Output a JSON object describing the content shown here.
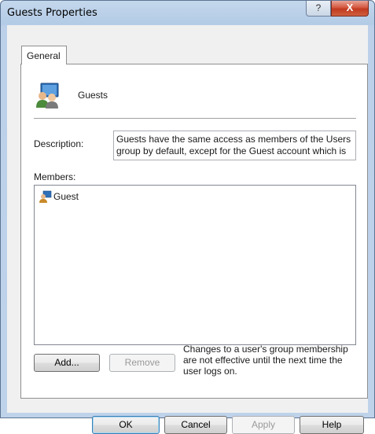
{
  "window": {
    "title": "Guests Properties",
    "help_glyph": "?",
    "close_glyph": "X"
  },
  "tabs": [
    {
      "label": "General"
    }
  ],
  "group": {
    "name": "Guests",
    "icon": "group-icon"
  },
  "description": {
    "label": "Description:",
    "line1": "Guests have the same access as members of the Users",
    "line2": "group by default, except for the Guest account which is"
  },
  "members": {
    "label": "Members:",
    "items": [
      {
        "label": "Guest",
        "icon": "user-icon"
      }
    ]
  },
  "member_buttons": {
    "add": "Add...",
    "remove": "Remove"
  },
  "note": {
    "line1": "Changes to a user's group membership",
    "line2": "are not effective until the next time the",
    "line3": "user logs on."
  },
  "dialog_buttons": {
    "ok": "OK",
    "cancel": "Cancel",
    "apply": "Apply",
    "help": "Help"
  },
  "colors": {
    "frame": "#bcd1e9",
    "client": "#f0f0f0",
    "close_button": "#c13a20"
  }
}
